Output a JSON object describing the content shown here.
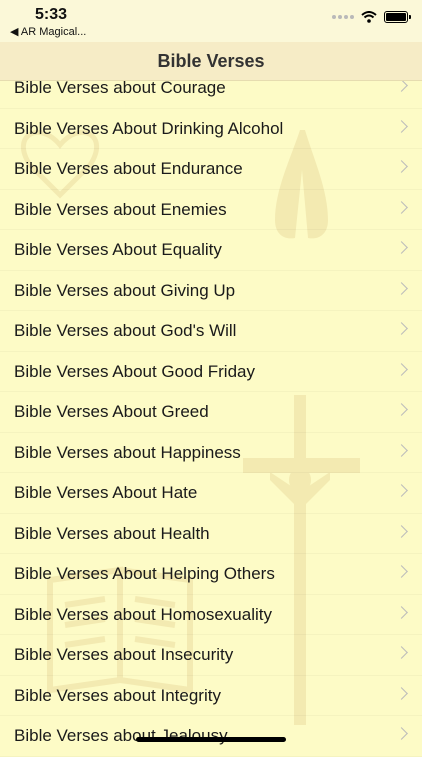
{
  "status_bar": {
    "time": "5:33",
    "back_app": "◀ AR Magical..."
  },
  "nav": {
    "title": "Bible Verses"
  },
  "list": [
    "Bible Verses about Courage",
    "Bible Verses About Drinking Alcohol",
    "Bible Verses about Endurance",
    "Bible Verses about Enemies",
    "Bible Verses About Equality",
    "Bible Verses about Giving Up",
    "Bible Verses about God's Will",
    "Bible Verses About Good Friday",
    "Bible Verses About Greed",
    "Bible Verses about Happiness",
    "Bible Verses About Hate",
    "Bible Verses about Health",
    "Bible Verses About Helping Others",
    "Bible Verses about Homosexuality",
    "Bible Verses about Insecurity",
    "Bible Verses about Integrity",
    "Bible Verses about Jealousy"
  ],
  "icons": {
    "chevron": "chevron-right-icon",
    "background_symbols": [
      "heart-icon",
      "praying-hands-icon",
      "crucifix-icon",
      "open-bible-icon"
    ]
  },
  "colors": {
    "background": "#fdfbc6",
    "nav_bar": "#f6ecc6",
    "art": "#b88a3a"
  }
}
